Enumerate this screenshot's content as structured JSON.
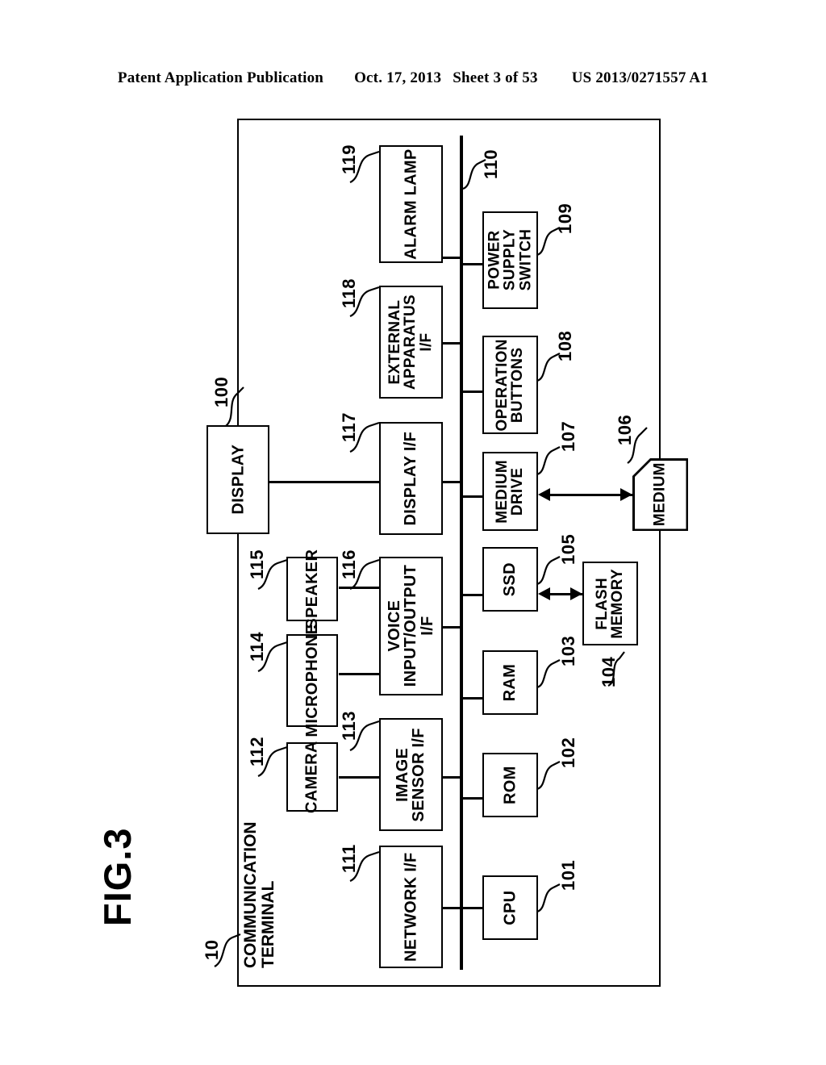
{
  "header": {
    "publication": "Patent Application Publication",
    "date": "Oct. 17, 2013",
    "sheet": "Sheet 3 of 53",
    "patent_number": "US 2013/0271557 A1"
  },
  "figure": {
    "label": "FIG.3",
    "terminal_ref": "10",
    "terminal_name": "COMMUNICATION\nTERMINAL",
    "terminal_name_line1": "COMMUNICATION",
    "terminal_name_line2": "TERMINAL"
  },
  "blocks": {
    "display": {
      "label": "DISPLAY",
      "ref": "100"
    },
    "alarm_lamp": {
      "label": "ALARM LAMP",
      "ref": "119"
    },
    "external_apparatus": {
      "label": "EXTERNAL\nAPPARATUS\nI/F",
      "ref": "118"
    },
    "display_if": {
      "label": "DISPLAY I/F",
      "ref": "117"
    },
    "voice_io_if": {
      "label": "VOICE\nINPUT/OUTPUT\nI/F",
      "ref": "116"
    },
    "image_sensor_if": {
      "label": "IMAGE\nSENSOR I/F",
      "ref": "113"
    },
    "network_if": {
      "label": "NETWORK I/F",
      "ref": "111"
    },
    "speaker": {
      "label": "SPEAKER",
      "ref": "115"
    },
    "microphone": {
      "label": "MICROPHONE",
      "ref": "114"
    },
    "camera": {
      "label": "CAMERA",
      "ref": "112"
    },
    "power_supply_switch": {
      "label": "POWER\nSUPPLY\nSWITCH",
      "ref": "109"
    },
    "operation_buttons": {
      "label": "OPERATION\nBUTTONS",
      "ref": "108"
    },
    "medium_drive": {
      "label": "MEDIUM\nDRIVE",
      "ref": "107"
    },
    "medium": {
      "label": "MEDIUM",
      "ref": "106"
    },
    "ssd": {
      "label": "SSD",
      "ref": "105"
    },
    "flash_memory": {
      "label": "FLASH\nMEMORY",
      "ref": "104"
    },
    "ram": {
      "label": "RAM",
      "ref": "103"
    },
    "rom": {
      "label": "ROM",
      "ref": "102"
    },
    "cpu": {
      "label": "CPU",
      "ref": "101"
    },
    "bus": {
      "label": "",
      "ref": "110"
    }
  },
  "colors": {
    "ink": "#000000",
    "paper": "#ffffff"
  }
}
